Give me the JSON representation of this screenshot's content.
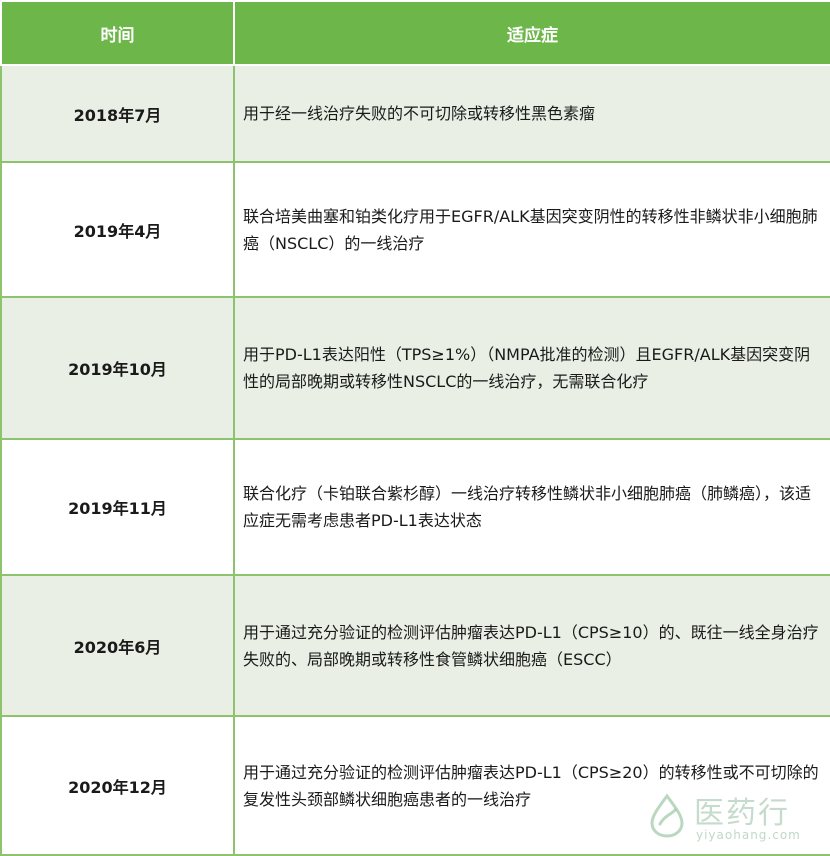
{
  "table": {
    "headers": {
      "date": "时间",
      "indication": "适应症"
    },
    "rows": [
      {
        "date": "2018年7月",
        "indication": "用于经一线治疗失败的不可切除或转移性黑色素瘤"
      },
      {
        "date": "2019年4月",
        "indication": "联合培美曲塞和铂类化疗用于EGFR/ALK基因突变阴性的转移性非鳞状非小细胞肺癌（NSCLC）的一线治疗"
      },
      {
        "date": "2019年10月",
        "indication": "用于PD-L1表达阳性（TPS≥1%）（NMPA批准的检测）且EGFR/ALK基因突变阴性的局部晚期或转移性NSCLC的一线治疗，无需联合化疗"
      },
      {
        "date": "2019年11月",
        "indication": "联合化疗（卡铂联合紫杉醇）一线治疗转移性鳞状非小细胞肺癌（肺鳞癌），该适应症无需考虑患者PD-L1表达状态"
      },
      {
        "date": "2020年6月",
        "indication": "用于通过充分验证的检测评估肿瘤表达PD-L1（CPS≥10）的、既往一线全身治疗失败的、局部晚期或转移性食管鳞状细胞癌（ESCC）"
      },
      {
        "date": "2020年12月",
        "indication": "用于通过充分验证的检测评估肿瘤表达PD-L1（CPS≥20）的转移性或不可切除的复发性头颈部鳞状细胞癌患者的一线治疗"
      }
    ]
  },
  "watermark": {
    "text": "医药行",
    "url": "yiyaohang.com",
    "logo_icon": "leaf-droplet-logo-icon"
  }
}
